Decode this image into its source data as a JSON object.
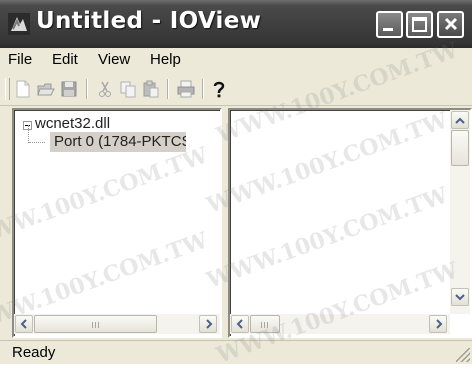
{
  "window": {
    "title": "Untitled - IOView"
  },
  "menu": {
    "items": [
      "File",
      "Edit",
      "View",
      "Help"
    ]
  },
  "toolbar": {
    "buttons": [
      "new-document-icon",
      "open-folder-icon",
      "save-icon",
      "cut-icon",
      "copy-icon",
      "paste-icon",
      "print-icon",
      "help-icon"
    ]
  },
  "tree": {
    "root": "wcnet32.dll",
    "child": "Port 0 (1784-PKTCS"
  },
  "status": {
    "text": "Ready"
  },
  "watermark": {
    "text": "WWW.100Y.COM.TW"
  }
}
